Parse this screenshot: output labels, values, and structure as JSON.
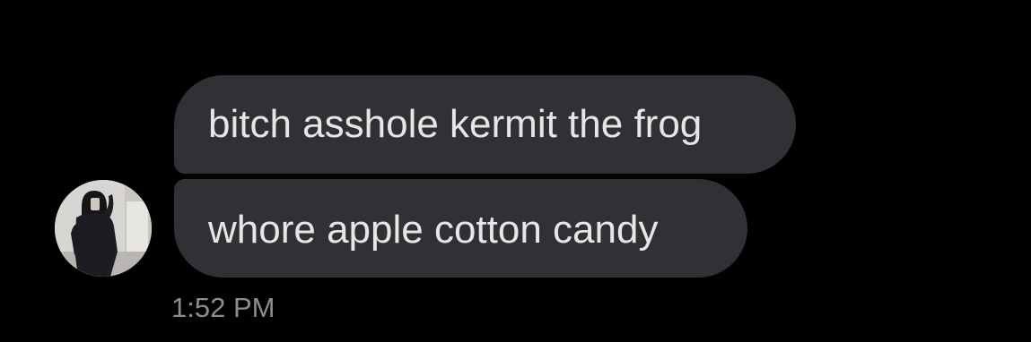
{
  "conversation": {
    "messages": [
      {
        "text": "bitch asshole kermit the frog"
      },
      {
        "text": "whore apple cotton candy"
      }
    ],
    "timestamp": "1:52 PM"
  },
  "sender": {
    "avatar_icon": "profile-photo"
  },
  "colors": {
    "background": "#000000",
    "bubble": "#2f3135",
    "message_text": "#e6e6e6",
    "timestamp_text": "#8b8d91"
  }
}
